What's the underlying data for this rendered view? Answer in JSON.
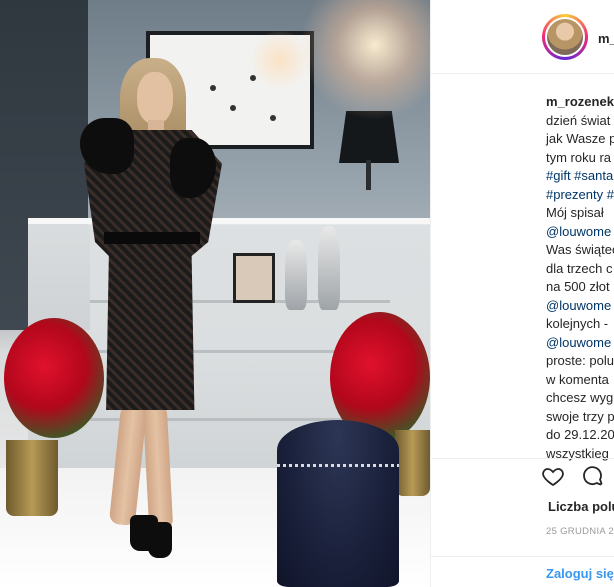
{
  "post": {
    "username": "m_rozenek",
    "header_username": "m_",
    "caption_lines": [
      {
        "user": "m_rozenek",
        "text": ""
      },
      {
        "text": "dzień świat"
      },
      {
        "text": "jak Wasze p"
      },
      {
        "text": "tym roku ra"
      },
      {
        "tag": "#gift #santa"
      },
      {
        "tag": "#prezenty #"
      },
      {
        "text": "Mój spisał"
      },
      {
        "tag": "@louwome"
      },
      {
        "text": "Was świątec"
      },
      {
        "text": "dla trzech c"
      },
      {
        "text": "na 500 złot"
      },
      {
        "tag": "@louwome"
      },
      {
        "text": "kolejnych -"
      },
      {
        "tag": "@louwome"
      },
      {
        "text": "proste: polu"
      },
      {
        "text": "w komenta"
      },
      {
        "text": "chcesz wyg"
      },
      {
        "text": "swoje trzy p"
      },
      {
        "text": "do 29.12.20"
      },
      {
        "text": "wszystkieg"
      }
    ],
    "likes_label": "Liczba polu",
    "date": "25 GRUDNIA 20",
    "login": {
      "link": "Zaloguj się",
      "rest": ""
    }
  },
  "icons": {
    "like": "heart-icon",
    "comment": "comment-icon"
  },
  "colors": {
    "tag": "#003569",
    "link": "#3897f0",
    "muted": "#999999",
    "border": "#efefef"
  }
}
